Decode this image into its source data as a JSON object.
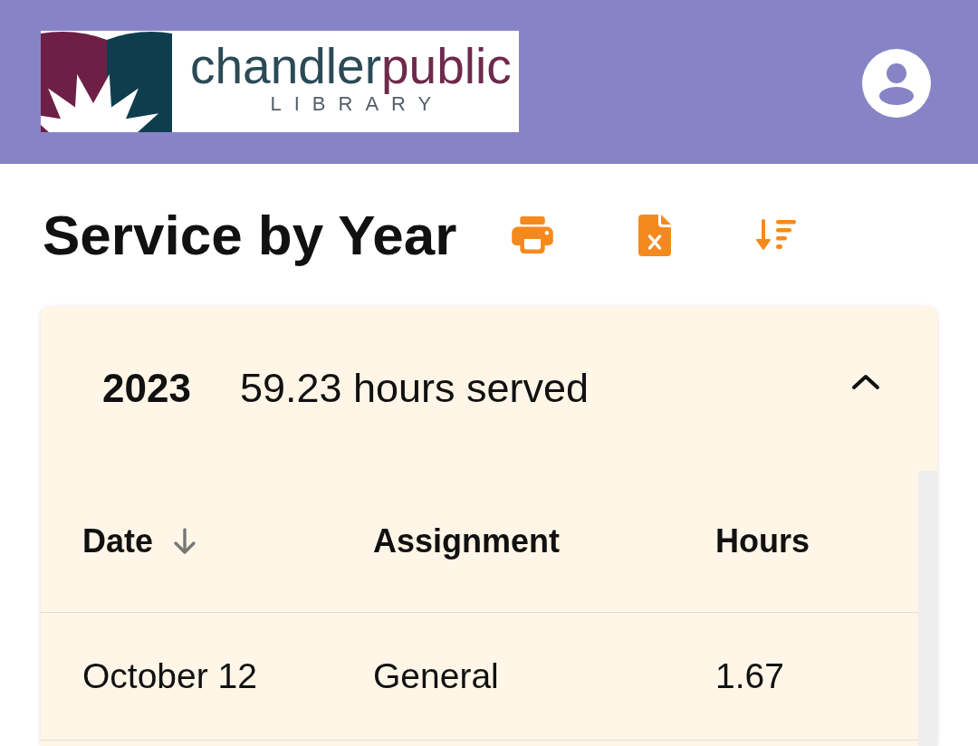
{
  "header": {
    "logo": {
      "wordmark": [
        "chandler",
        "public"
      ],
      "subtitle": "LIBRARY"
    }
  },
  "page_title": "Service by Year",
  "years": [
    {
      "year": "2023",
      "summary": "59.23 hours served",
      "expanded": true,
      "table": {
        "columns": [
          {
            "label": "Date",
            "sorted": true
          },
          {
            "label": "Assignment",
            "sorted": false
          },
          {
            "label": "Hours",
            "sorted": false
          }
        ],
        "rows": [
          {
            "cells": [
              "October 12",
              "General",
              "1.67"
            ]
          }
        ]
      }
    }
  ]
}
